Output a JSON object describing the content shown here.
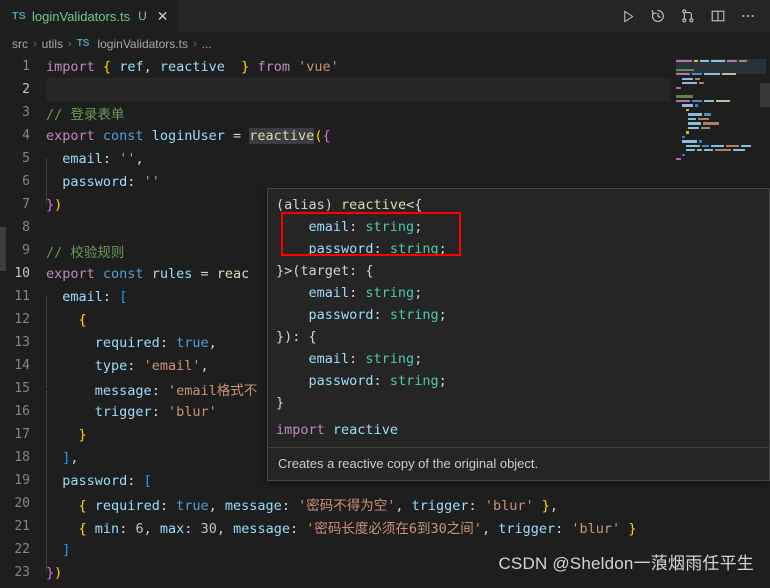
{
  "window": {
    "background": "#1e1e1e",
    "tab_bar_background": "#252526"
  },
  "tab": {
    "icon_label": "TS",
    "title": "loginValidators.ts",
    "state_badge": "U",
    "close_glyph": "✕"
  },
  "tab_actions": [
    {
      "name": "run-button",
      "label": "Run"
    },
    {
      "name": "history-button",
      "label": "Timeline"
    },
    {
      "name": "source-control-button",
      "label": "Source Control"
    },
    {
      "name": "split-editor-button",
      "label": "Split Editor"
    },
    {
      "name": "more-actions-button",
      "label": "More Actions"
    }
  ],
  "breadcrumb": {
    "items": [
      "src",
      "utils",
      "loginValidators.ts",
      "..."
    ],
    "file_icon_label": "TS",
    "separator": "›"
  },
  "editor": {
    "language": "typescript",
    "line_count": 23,
    "current_line": 10,
    "lines": [
      {
        "n": 1,
        "text": "import { ref, reactive  } from 'vue'"
      },
      {
        "n": 2,
        "text": ""
      },
      {
        "n": 3,
        "text": "// 登录表单"
      },
      {
        "n": 4,
        "text": "export const loginUser = reactive({"
      },
      {
        "n": 5,
        "text": "  email: '',"
      },
      {
        "n": 6,
        "text": "  password: ''"
      },
      {
        "n": 7,
        "text": "})"
      },
      {
        "n": 8,
        "text": ""
      },
      {
        "n": 9,
        "text": "// 校验规则"
      },
      {
        "n": 10,
        "text": "export const rules = reactive({"
      },
      {
        "n": 11,
        "text": "  email: ["
      },
      {
        "n": 12,
        "text": "    {"
      },
      {
        "n": 13,
        "text": "      required: true,"
      },
      {
        "n": 14,
        "text": "      type: 'email',"
      },
      {
        "n": 15,
        "text": "      message: 'email格式不正确',"
      },
      {
        "n": 16,
        "text": "      trigger: 'blur'"
      },
      {
        "n": 17,
        "text": "    }"
      },
      {
        "n": 18,
        "text": "  ],"
      },
      {
        "n": 19,
        "text": "  password: ["
      },
      {
        "n": 20,
        "text": "    { required: true, message: '密码不得为空', trigger: 'blur' },"
      },
      {
        "n": 21,
        "text": "    { min: 6, max: 30, message: '密码长度必须在6到30之间', trigger: 'blur' }"
      },
      {
        "n": 22,
        "text": "  ]"
      },
      {
        "n": 23,
        "text": "})"
      }
    ],
    "tokens": {
      "l1": {
        "import": "import",
        "brace_open": "{",
        "ref": "ref",
        "comma": ",",
        "reactive": "reactive",
        "brace_close": "}",
        "from": "from",
        "module": "'vue'"
      },
      "l3": {
        "comment": "// 登录表单"
      },
      "l4": {
        "export": "export",
        "const": "const",
        "name": "loginUser",
        "eq": "=",
        "fn": "reactive",
        "paren": "(",
        "brace": "{"
      },
      "l5": {
        "key": "email",
        "colon": ":",
        "value": "''",
        "comma": ","
      },
      "l6": {
        "key": "password",
        "colon": ":",
        "value": "''"
      },
      "l7": {
        "brace": "}",
        "paren": ")"
      },
      "l9": {
        "comment": "// 校验规则"
      },
      "l10": {
        "export": "export",
        "const": "const",
        "name": "rules",
        "eq": "=",
        "fn": "reac"
      },
      "l11": {
        "key": "email",
        "colon": ":",
        "bracket": "["
      },
      "l12": {
        "brace": "{"
      },
      "l13": {
        "key": "required",
        "colon": ":",
        "value": "true",
        "comma": ","
      },
      "l14": {
        "key": "type",
        "colon": ":",
        "value": "'email'",
        "comma": ","
      },
      "l15": {
        "key": "message",
        "colon": ":",
        "value": "'email格式不"
      },
      "l16": {
        "key": "trigger",
        "colon": ":",
        "value": "'blur'"
      },
      "l17": {
        "brace": "}"
      },
      "l18": {
        "bracket": "]",
        "comma": ","
      },
      "l19": {
        "key": "password",
        "colon": ":",
        "bracket": "["
      },
      "l20": {
        "brace_open": "{",
        "k1": "required",
        "v1": "true",
        "k2": "message",
        "v2": "'密码不得为空'",
        "k3": "trigger",
        "v3": "'blur'",
        "brace_close": "}",
        "comma": ","
      },
      "l21": {
        "brace_open": "{",
        "k1": "min",
        "v1": "6",
        "k2": "max",
        "v2": "30",
        "k3": "message",
        "v3": "'密码长度必须在6到30之间'",
        "k4": "trigger",
        "v4": "'blur'",
        "brace_close": "}"
      },
      "l22": {
        "bracket": "]"
      },
      "l23": {
        "brace": "}",
        "paren": ")"
      }
    }
  },
  "hover_tooltip": {
    "signature_lines": [
      "(alias) reactive<{",
      "    email: string;",
      "    password: string;",
      "}>(target: {",
      "    email: string;",
      "    password: string;",
      "}): {",
      "    email: string;",
      "    password: string;",
      "}"
    ],
    "signature_parts": {
      "alias": "(alias)",
      "fn": "reactive",
      "generic_open": "<{",
      "email_key": "email",
      "password_key": "password",
      "type_string": "string",
      "semicolon": ";",
      "target_label": "}>(target: {",
      "return_label": "}): {",
      "close_brace": "}"
    },
    "import_line": {
      "keyword": "import",
      "symbol": "reactive"
    },
    "description": "Creates a reactive copy of the original object."
  },
  "annotation": {
    "type": "red-rectangle-highlight",
    "color": "#ff0000",
    "covers": [
      "email: string;",
      "password: string;"
    ]
  },
  "watermark": {
    "text": "CSDN @Sheldon一蒗烟雨任平生"
  },
  "colors": {
    "editor_bg": "#1e1e1e",
    "tabbar_bg": "#252526",
    "line_number": "#858585",
    "keyword_purple": "#c586c0",
    "keyword_blue": "#569cd6",
    "identifier": "#9cdcfe",
    "function": "#dcdcaa",
    "string": "#ce9178",
    "number": "#b5cea8",
    "comment": "#6a9955",
    "type": "#4ec9b0",
    "bracket1": "#ffd700",
    "bracket2": "#da70d6",
    "bracket3": "#179fff",
    "tab_modified_green": "#73c991",
    "ts_icon_blue": "#519aba",
    "tooltip_bg": "#252526",
    "tooltip_border": "#454545"
  }
}
